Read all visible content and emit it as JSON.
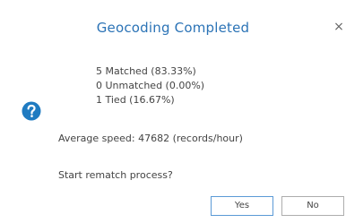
{
  "dialog": {
    "title": "Geocoding Completed",
    "close_glyph": "×",
    "icon": "question-icon",
    "accent_color": "#2b73b6",
    "stats": {
      "matched": "5 Matched (83.33%)",
      "unmatched": "0 Unmatched (0.00%)",
      "tied": "1 Tied (16.67%)"
    },
    "speed": "Average speed: 47682 (records/hour)",
    "prompt": "Start rematch process?",
    "buttons": {
      "yes": "Yes",
      "no": "No"
    }
  }
}
